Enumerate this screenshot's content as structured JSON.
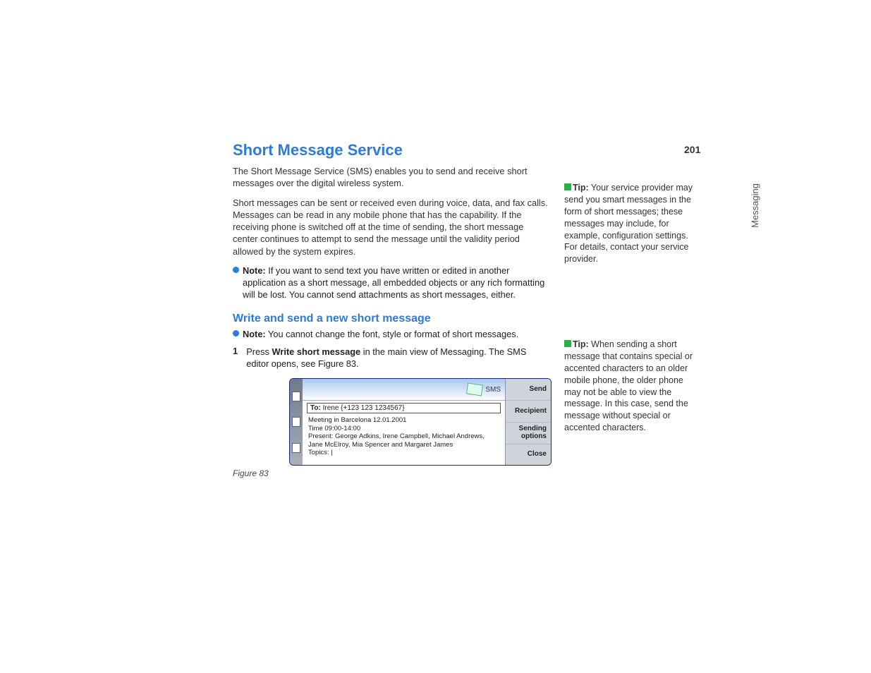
{
  "page_number": "201",
  "section_label": "Messaging",
  "heading": "Short Message Service",
  "intro_1": "The Short Message Service (SMS) enables you to send and receive short messages over the digital wireless system.",
  "intro_2": "Short messages can be sent or received even during voice, data, and fax calls. Messages can be read in any mobile phone that has the capability. If the receiving phone is switched off at the time of sending, the short message center continues to attempt to send the message until the validity period allowed by the system expires.",
  "note1_label": "Note:",
  "note1_body": " If you want to send text you have written or edited in another application as a short message, all embedded objects or any rich formatting will be lost. You cannot send attachments as short messages, either.",
  "sub_heading": "Write and send a new short message",
  "note2_label": "Note:",
  "note2_body": " You cannot change the font, style or format of short messages.",
  "step_num": "1",
  "step_pre": "Press ",
  "step_bold": "Write short message",
  "step_post": " in the main view of Messaging. The SMS editor opens, see Figure 83.",
  "tip1_label": "Tip:",
  "tip1_body": " Your service provider may send you smart messages in the form of short messages; these messages may include, for example, configuration settings. For details, contact your service provider.",
  "tip2_label": "Tip:",
  "tip2_body": " When sending a short message that contains special or accented characters to an older mobile phone, the older phone may not be able to view the message. In this case, send the message without special or accented characters.",
  "figure_caption": "Figure 83",
  "device": {
    "sms_label": "SMS",
    "to_label": "To:",
    "to_value": " Irene {+123 123 1234567}",
    "line1": "Meeting in Barcelona 12.01.2001",
    "line2": "Time 09:00-14:00",
    "line3": "Present: George Adkins, Irene Campbell, Michael Andrews, Jane McElroy, Mia Spencer and Margaret James",
    "line4": "Topics: |",
    "btn_send": "Send",
    "btn_recipient": "Recipient",
    "btn_sending_options": "Sending options",
    "btn_close": "Close"
  }
}
